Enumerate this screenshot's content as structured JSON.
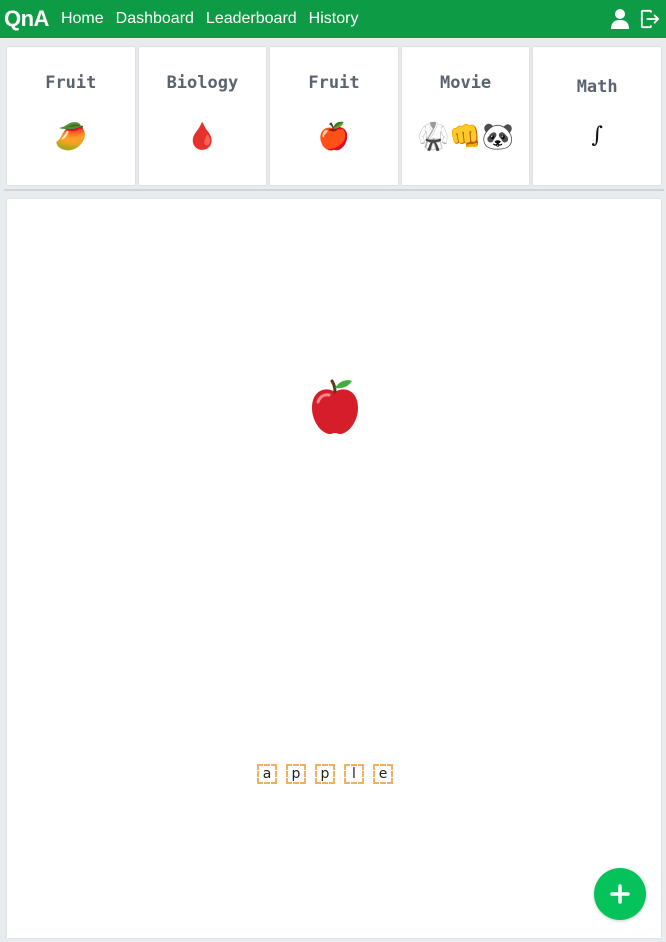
{
  "navbar": {
    "brand": "QnA",
    "links": [
      "Home",
      "Dashboard",
      "Leaderboard",
      "History"
    ],
    "icons": [
      "user-icon",
      "logout-icon"
    ],
    "color": "#0e9b45"
  },
  "cards": [
    {
      "title": "Fruit",
      "emoji": "🥭"
    },
    {
      "title": "Biology",
      "emoji": "🩸"
    },
    {
      "title": "Fruit",
      "emoji": "🍎"
    },
    {
      "title": "Movie",
      "emoji": "🥋👊🐼"
    },
    {
      "title": "Math",
      "emoji": "∫"
    }
  ],
  "question": {
    "emoji": "🍎",
    "letters": [
      "a",
      "p",
      "p",
      "l",
      "e"
    ]
  },
  "fab": {
    "icon": "plus-icon",
    "color": "#06c25a"
  }
}
